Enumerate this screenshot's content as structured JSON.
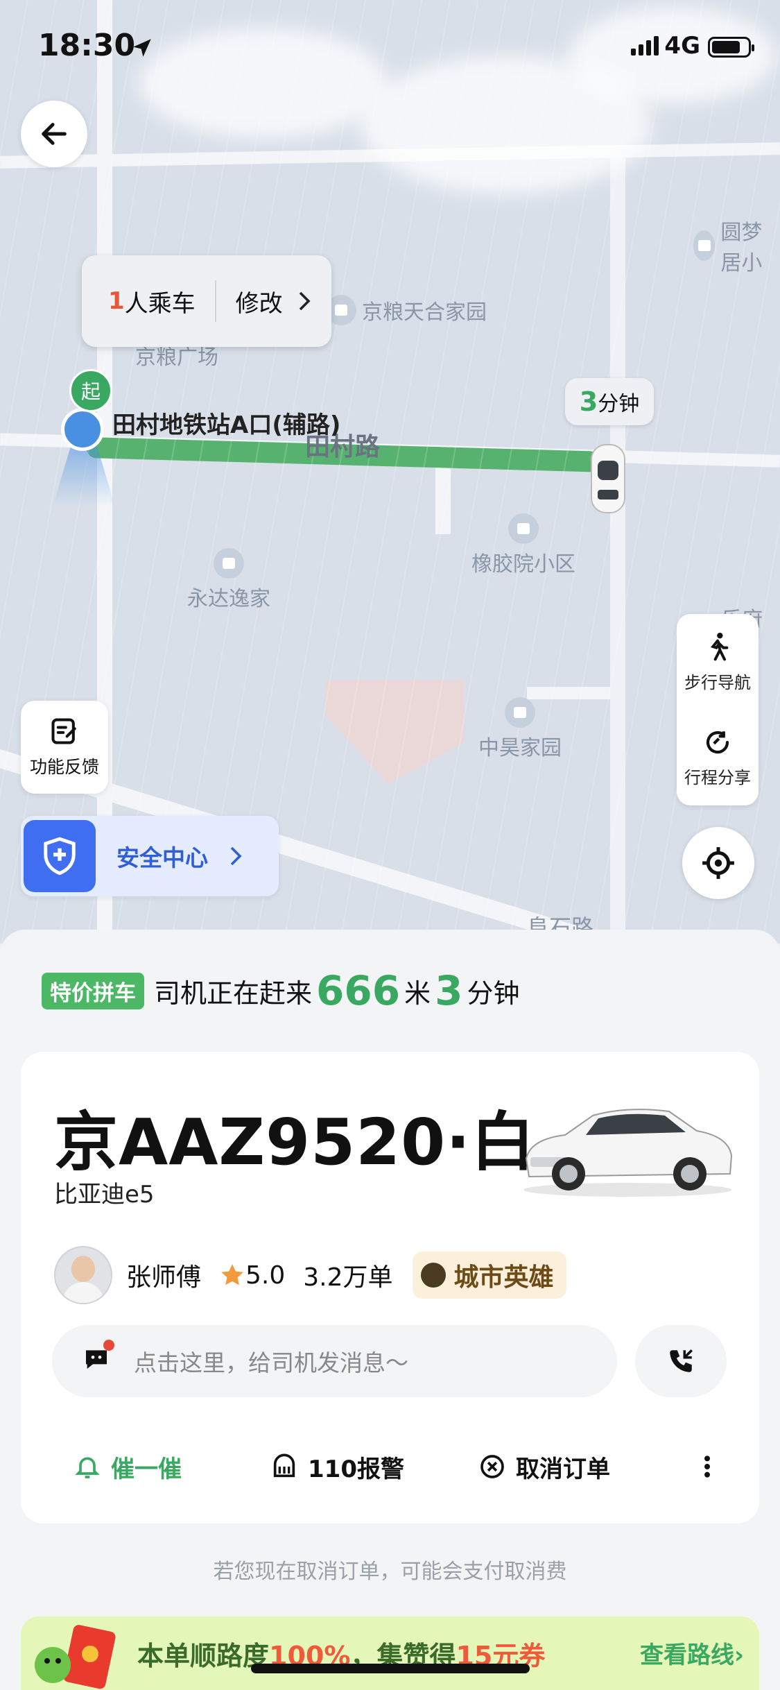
{
  "status_bar": {
    "time": "18:30",
    "network": "4G"
  },
  "map": {
    "passenger_count": "1",
    "passenger_suffix": "人乘车",
    "modify_label": "修改",
    "pickup_badge": "起",
    "pickup_label": "田村地铁站A口(辅路)",
    "road_name": "田村路",
    "eta_minutes": "3",
    "eta_unit": "分钟",
    "pois": [
      "京粮天合家园",
      "圆梦居小",
      "橡胶院小区",
      "永达逸家",
      "中昊家园",
      "京粮广场",
      "阜石路",
      "乐府江"
    ],
    "walk_nav_label": "步行导航",
    "trip_share_label": "行程分享",
    "feedback_label": "功能反馈",
    "safety_label": "安全中心"
  },
  "sheet": {
    "tag": "特价拼车",
    "status_text": "司机正在赶来",
    "distance": "666",
    "distance_unit": "米",
    "minutes": "3",
    "minutes_unit": "分钟",
    "plate": "京AAZ9520·白",
    "car_model": "比亚迪e5",
    "driver_name": "张师傅",
    "rating": "5.0",
    "orders": "3.2万单",
    "badge": "城市英雄",
    "message_placeholder": "点击这里，给司机发消息～",
    "actions": {
      "urge": "催一催",
      "police": "110报警",
      "cancel": "取消订单"
    },
    "notice": "若您现在取消订单，可能会支付取消费",
    "promo": {
      "prefix": "本单顺路度",
      "percent": "100%",
      "middle": "，集赞得",
      "coupon": "15元券",
      "link": "查看路线"
    }
  },
  "colors": {
    "accent_green": "#39a860",
    "route_green": "#57b26f",
    "safety_blue": "#3f6ff0"
  }
}
